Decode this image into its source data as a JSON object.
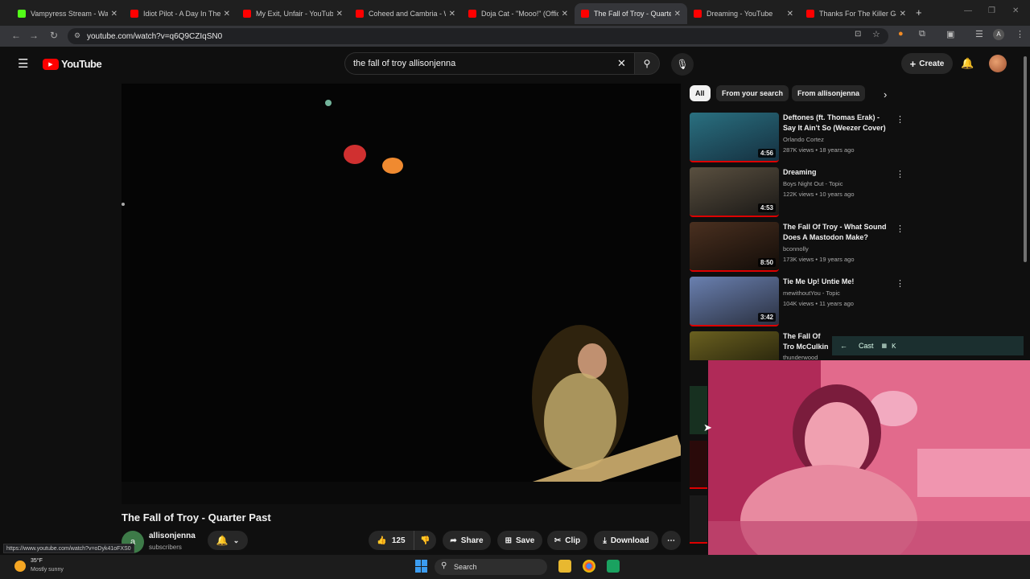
{
  "browser": {
    "tabs": [
      {
        "title": "Vampyress Stream - Watch",
        "favicon_color": "#53fc18"
      },
      {
        "title": "Idiot Pilot - A Day In The L",
        "favicon_color": "#ff0000"
      },
      {
        "title": "My Exit, Unfair - YouTube",
        "favicon_color": "#ff0000"
      },
      {
        "title": "Coheed and Cambria - Wi",
        "favicon_color": "#ff0000"
      },
      {
        "title": "Doja Cat - \"Mooo!\" (Offici",
        "favicon_color": "#ff0000"
      },
      {
        "title": "The Fall of Troy - Quarter P",
        "favicon_color": "#ff0000",
        "active": true
      },
      {
        "title": "Dreaming - YouTube",
        "favicon_color": "#ff0000"
      },
      {
        "title": "Thanks For The Killer Gam",
        "favicon_color": "#ff0000"
      }
    ],
    "url": "youtube.com/watch?v=q6Q9CZIqSN0"
  },
  "youtube": {
    "logo_text": "YouTube",
    "search_query": "the fall of troy allisonjenna",
    "create_label": "Create"
  },
  "video": {
    "title": "The Fall of Troy - Quarter Past",
    "channel": "allisonjenna",
    "channel_initial": "a",
    "subscribers": "subscribers",
    "likes": "125",
    "share_label": "Share",
    "save_label": "Save",
    "clip_label": "Clip",
    "download_label": "Download"
  },
  "chips": [
    "All",
    "From your search",
    "From allisonjenna"
  ],
  "recommendations": [
    {
      "title": "Deftones (ft. Thomas Erak) - Say It Ain't So (Weezer Cover)",
      "channel": "Orlando Cortez",
      "meta": "287K views • 18 years ago",
      "duration": "4:56",
      "thumb": "#1e4e5a"
    },
    {
      "title": "Dreaming",
      "channel": "Boys Night Out - Topic",
      "meta": "122K views • 10 years ago",
      "duration": "4:53",
      "thumb": "#3a3530"
    },
    {
      "title": "The Fall Of Troy - What Sound Does A Mastodon Make?",
      "channel": "bconnolly",
      "meta": "173K views • 19 years ago",
      "duration": "8:50",
      "thumb": "#2a1e18"
    },
    {
      "title": "Tie Me Up! Untie Me!",
      "channel": "mewithoutYou - Topic",
      "meta": "104K views • 11 years ago",
      "duration": "3:42",
      "thumb": "#3b4a6a"
    },
    {
      "title": "The Fall Of Tro McCulkin",
      "channel": "thunderwood",
      "meta": "",
      "duration": "",
      "thumb": "#2a2a10"
    }
  ],
  "cast": {
    "label": "Cast",
    "shortcut": "K"
  },
  "status_url": "https://www.youtube.com/watch?v=oDyk41oFXS0",
  "taskbar": {
    "temperature": "35°F",
    "weather": "Mostly sunny",
    "search_label": "Search"
  },
  "colors": {
    "yt_red": "#ff0000",
    "background": "#0f0f0f",
    "accent_blue": "#3ea6ff"
  }
}
